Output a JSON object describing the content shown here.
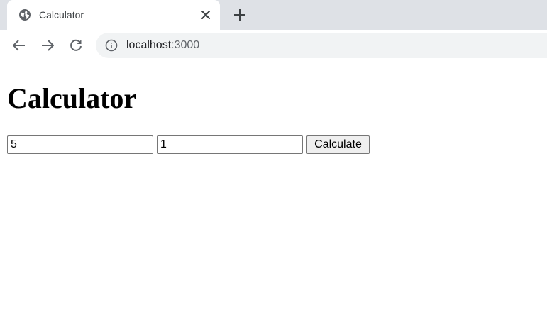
{
  "browser": {
    "tab": {
      "title": "Calculator",
      "favicon": "globe-icon",
      "close_icon": "close-icon"
    },
    "new_tab_icon": "plus-icon",
    "nav": {
      "back_icon": "arrow-left-icon",
      "forward_icon": "arrow-right-icon",
      "reload_icon": "reload-icon"
    },
    "address_bar": {
      "info_icon": "info-icon",
      "url_host": "localhost",
      "url_port": ":3000"
    }
  },
  "page": {
    "heading": "Calculator",
    "first_number": "5",
    "second_number": "1",
    "calculate_label": "Calculate"
  },
  "colors": {
    "tabstrip_bg": "#dee1e6",
    "omnibox_bg": "#f1f3f4",
    "button_bg": "#efefef"
  }
}
